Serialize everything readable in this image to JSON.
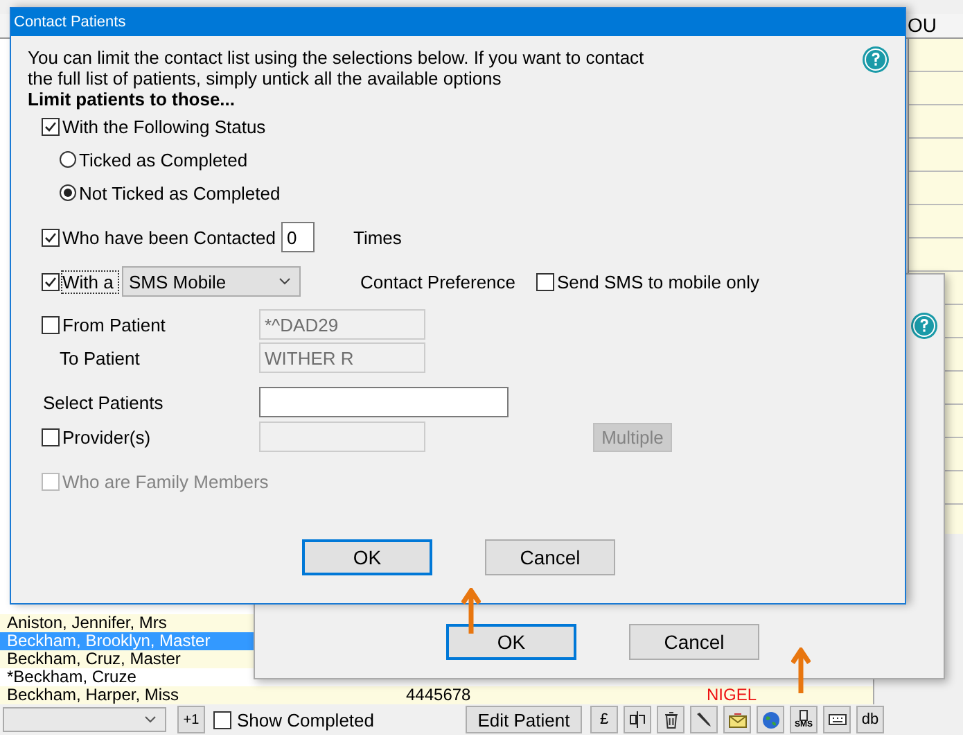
{
  "background": {
    "header": "OU",
    "patients": [
      {
        "name": "Aniston, Jennifer, Mrs",
        "selected": false
      },
      {
        "name": "Beckham, Brooklyn, Master",
        "selected": true
      },
      {
        "name": "Beckham, Cruz, Master",
        "selected": false
      },
      {
        "name": "*Beckham, Cruze",
        "selected": false
      },
      {
        "name": "Beckham, Harper, Miss",
        "selected": false,
        "number": "4445678",
        "provider": "NIGEL"
      }
    ],
    "toolbar": {
      "plus_button": "+1",
      "show_completed": {
        "label": "Show Completed",
        "checked": false
      },
      "edit_button": "Edit Patient",
      "icon_buttons": [
        {
          "kind": "text",
          "label": "£"
        },
        {
          "kind": "split"
        },
        {
          "kind": "trash"
        },
        {
          "kind": "pen"
        },
        {
          "kind": "mail"
        },
        {
          "kind": "globe"
        },
        {
          "kind": "sms",
          "label": "SMS"
        },
        {
          "kind": "keyboard"
        },
        {
          "kind": "text",
          "label": "db"
        }
      ]
    }
  },
  "back_dialog": {
    "buttons": [
      {
        "label": "OK",
        "focused": true
      },
      {
        "label": "Cancel",
        "focused": false
      }
    ]
  },
  "dialog": {
    "title": "Contact Patients",
    "intro": "You can limit the contact list using the selections below. If you want to contact\nthe full list of patients, simply untick all the available options",
    "heading": "Limit patients to those...",
    "status": {
      "label": "With the Following Status",
      "checked": true,
      "options": [
        {
          "label": "Ticked as Completed",
          "selected": false
        },
        {
          "label": "Not Ticked as Completed",
          "selected": true
        }
      ]
    },
    "contacted": {
      "label": "Who have been Contacted",
      "checked": true,
      "value": "0",
      "suffix": "Times"
    },
    "with": {
      "label": "With a",
      "checked": true,
      "select": "SMS Mobile",
      "note": "Contact Preference"
    },
    "sms_only": {
      "label": "Send SMS to mobile only",
      "checked": false
    },
    "from": {
      "label": "From Patient",
      "checked": false,
      "value": "*^DAD29",
      "disabled": true
    },
    "to": {
      "label": "To Patient",
      "value": "WITHER R",
      "disabled": true
    },
    "select_patients": {
      "label": "Select Patients"
    },
    "providers": {
      "label": "Provider(s)",
      "checked": false,
      "field_disabled": true,
      "button": "Multiple",
      "button_disabled": true
    },
    "family": {
      "label": "Who are Family Members",
      "checked": false,
      "disabled": true
    },
    "buttons": [
      {
        "label": "OK",
        "focused": true
      },
      {
        "label": "Cancel",
        "focused": false
      }
    ]
  }
}
